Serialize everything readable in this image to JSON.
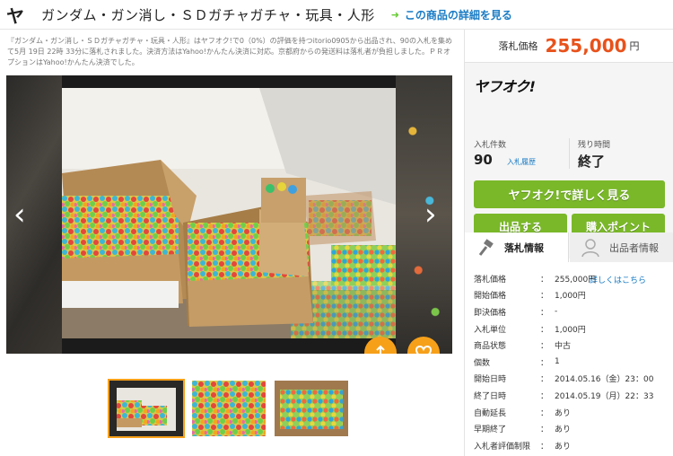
{
  "header": {
    "logo": "ヤ",
    "title": "ガンダム・ガン消し・ＳＤガチャガチャ・玩具・人形",
    "detail_link": "この商品の詳細を見る"
  },
  "description": "『ガンダム・ガン消し・ＳＤガチャガチャ・玩具・人形』はヤフオク!で0（0%）の評価を持つitorio0905から出品され、90の入札を集めて5月 19日 22時 33分に落札されました。決済方法はYahoo!かんたん決済に対応。京都府からの発送料は落札者が負担しました。ＰＲオプションはYahoo!かんたん決済でした。",
  "viewer": {
    "prev": "‹",
    "next": "›"
  },
  "price": {
    "label": "落札価格",
    "value": "255,000",
    "unit": "円"
  },
  "brand": "ヤフオク!",
  "stats": {
    "bids_label": "入札件数",
    "bids_value": "90",
    "history_link": "入札履歴",
    "time_label": "残り時間",
    "time_value": "終了"
  },
  "buttons": {
    "detail": "ヤフオク!で詳しく見る",
    "sell": "出品する",
    "points": "購入ポイント",
    "help_mark": "?",
    "help_link": "詳しくはこちら"
  },
  "tabs": {
    "bid_info": "落札情報",
    "seller_info": "出品者情報"
  },
  "info_rows": [
    {
      "k": "落札価格",
      "v": "255,000円"
    },
    {
      "k": "開始価格",
      "v": "1,000円"
    },
    {
      "k": "即決価格",
      "v": "-"
    },
    {
      "k": "入札単位",
      "v": "1,000円"
    },
    {
      "k": "商品状態",
      "v": "中古"
    },
    {
      "k": "個数",
      "v": "1"
    },
    {
      "k": "開始日時",
      "v": "2014.05.16（金）23：00"
    },
    {
      "k": "終了日時",
      "v": "2014.05.19（月）22：33"
    },
    {
      "k": "自動延長",
      "v": "あり"
    },
    {
      "k": "早期終了",
      "v": "あり"
    },
    {
      "k": "入札者評価制限",
      "v": "あり"
    }
  ],
  "colors": {
    "accent_orange": "#f6a01a",
    "price_red": "#e8521b",
    "button_green": "#7ab829",
    "link_blue": "#1a7cc5"
  }
}
